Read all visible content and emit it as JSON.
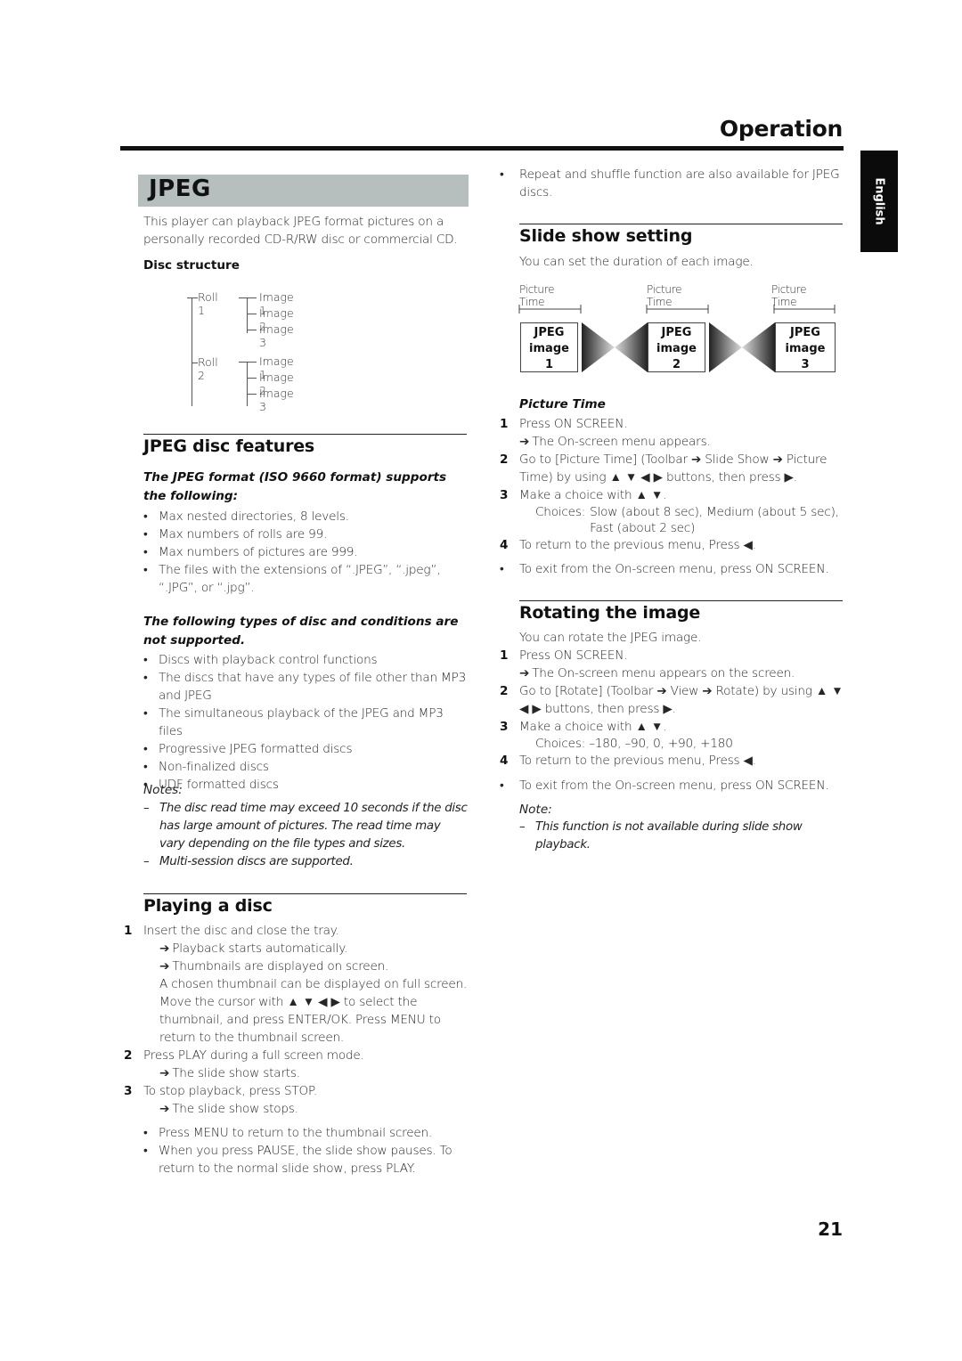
{
  "header": {
    "section_title": "Operation",
    "language_tab": "English"
  },
  "jpeg": {
    "banner_title": "JPEG",
    "intro": [
      "This player can playback JPEG format pictures on a",
      "personally recorded CD-R/RW disc or commercial CD."
    ],
    "disc_structure": {
      "title": "Disc structure",
      "rolls": [
        {
          "label": "Roll 1",
          "images": [
            "Image 1",
            "Image 2",
            "Image 3"
          ]
        },
        {
          "label": "Roll 2",
          "images": [
            "Image 1",
            "Image 2",
            "Image 3"
          ]
        }
      ]
    }
  },
  "features": {
    "title": "JPEG disc features",
    "supports_heading": "The JPEG format (ISO 9660 format) supports the following:",
    "supports": [
      "Max nested directories, 8 levels.",
      "Max numbers of rolls are 99.",
      "Max numbers of pictures are 999.",
      "The files with the extensions of “.JPEG”, “.jpeg”, “.JPG”, or “.jpg”."
    ],
    "unsupported_heading": "The following types of disc and conditions are not supported.",
    "unsupported": [
      "Discs with playback control functions",
      "The discs that have any types of file other than MP3 and JPEG",
      "The simultaneous playback of the JPEG and MP3 files",
      "Progressive JPEG formatted discs",
      "Non-finalized discs",
      "UDF formatted discs"
    ],
    "notes_label": "Notes:",
    "notes": [
      "The disc read time may exceed 10 seconds if the disc has large amount of pictures. The read time may vary depending on the file types and sizes.",
      "Multi-session discs are supported."
    ]
  },
  "playing": {
    "title": "Playing a disc",
    "steps": [
      {
        "num": "1",
        "text": "Insert the disc and close the tray.",
        "results": [
          "Playback starts automatically.",
          "Thumbnails are displayed on screen."
        ],
        "extra": "A chosen thumbnail can be displayed on full screen. Move the cursor with ▲ ▼ ◀ ▶ to select the thumbnail, and press ENTER/OK. Press MENU to return to the thumbnail screen."
      },
      {
        "num": "2",
        "text": "Press PLAY during a full screen mode.",
        "results": [
          "The slide show starts."
        ]
      },
      {
        "num": "3",
        "text": "To stop playback, press STOP.",
        "results": [
          "The slide show stops."
        ]
      }
    ],
    "bullets": [
      "Press MENU to return to the thumbnail screen.",
      "When you press PAUSE, the slide show pauses. To return to the normal slide show, press PLAY."
    ]
  },
  "right_top_bullet": "Repeat and shuffle function are also available for JPEG discs.",
  "slideshow": {
    "title": "Slide show setting",
    "intro": "You can set the duration of each image.",
    "diagram": {
      "time_label": "Picture Time",
      "images": [
        {
          "line1": "JPEG",
          "line2": "image",
          "line3": "1"
        },
        {
          "line1": "JPEG",
          "line2": "image",
          "line3": "2"
        },
        {
          "line1": "JPEG",
          "line2": "image",
          "line3": "3"
        }
      ]
    },
    "subheading": "Picture Time",
    "steps": [
      {
        "num": "1",
        "text": "Press ON SCREEN.",
        "result": "The On-screen menu appears."
      },
      {
        "num": "2",
        "text": "Go to [Picture Time] (Toolbar ➔ Slide Show ➔ Picture Time) by using ▲ ▼ ◀ ▶ buttons, then press ▶."
      },
      {
        "num": "3",
        "text": "Make a choice with ▲ ▼.",
        "choices_label": "Choices:",
        "choices": "Slow (about 8 sec), Medium (about 5 sec), Fast (about 2 sec)"
      },
      {
        "num": "4",
        "text": "To return to the previous menu, Press ◀."
      }
    ],
    "bullet": "To exit from the On-screen menu, press ON SCREEN."
  },
  "rotating": {
    "title": "Rotating the image",
    "intro": "You can rotate the JPEG image.",
    "steps": [
      {
        "num": "1",
        "text": "Press ON SCREEN.",
        "result": "The On-screen menu appears on the screen."
      },
      {
        "num": "2",
        "text": "Go to [Rotate] (Toolbar ➔ View ➔ Rotate) by using ▲ ▼ ◀ ▶ buttons, then press ▶."
      },
      {
        "num": "3",
        "text": "Make a choice with ▲ ▼.",
        "choices": "Choices: –180, –90, 0, +90, +180"
      },
      {
        "num": "4",
        "text": "To return to the previous menu, Press ◀."
      }
    ],
    "bullet": "To exit from the On-screen menu, press ON SCREEN.",
    "note_label": "Note:",
    "note": "This function is not available during slide show playback."
  },
  "page_number": "21"
}
